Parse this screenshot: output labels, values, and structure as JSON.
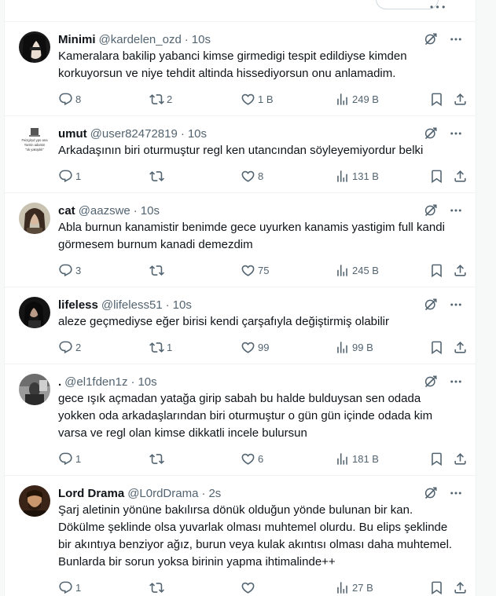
{
  "top": {
    "more_label": "• • •"
  },
  "tweets": [
    {
      "name": "Minimi",
      "handle": "@kardelen_ozd",
      "sep": "·",
      "time": "10s",
      "lines": [
        "Kameralara bakilip yabanci kimse girmedigi tespit edildiyse kimden",
        "korkuyorsun ve niye tehdit altinda hissediyorsun onu anlamadim."
      ],
      "replies": "8",
      "retweets": "2",
      "likes": "1 B",
      "views": "249 B",
      "avatar": "dark-hair"
    },
    {
      "name": "umut",
      "handle": "@user82472819",
      "sep": "·",
      "time": "10s",
      "lines": [
        "Arkadaşının biri oturmuştur regl ken utancından söyleyemiyordur belki"
      ],
      "replies": "1",
      "retweets": "",
      "likes": "8",
      "views": "131 B",
      "avatar": "text-meme",
      "avatar_text": [
        "Feizgiryd ypo ana",
        "Yarnin adamin",
        "\"ok yakışıklı\""
      ]
    },
    {
      "name": "cat",
      "handle": "@aazswe",
      "sep": "·",
      "time": "10s",
      "lines": [
        "Abla burnun kanamistir benimde gece uyurken kanamis yastigim full kandi",
        "görmesem burnum kanadi demezdim"
      ],
      "replies": "3",
      "retweets": "",
      "likes": "75",
      "views": "245 B",
      "avatar": "portrait-light"
    },
    {
      "name": "lifeless",
      "handle": "@lifeless51",
      "sep": "·",
      "time": "10s",
      "lines": [
        "aleze geçmediyse eğer birisi kendi çarşafıyla değiştirmiş olabilir"
      ],
      "replies": "2",
      "retweets": "1",
      "likes": "99",
      "views": "99 B",
      "avatar": "portrait-dark"
    },
    {
      "name": ".",
      "handle": "@el1fden1z",
      "sep": "·",
      "time": "10s",
      "lines": [
        "gece ışık açmadan yatağa girip sabah bu halde bulduysan sen odada",
        "yokken oda arkadaşlarından biri oturmuştur o gün gün içinde odada kim",
        "varsa ve regl olan kimse dikkatli incele bulursun"
      ],
      "replies": "1",
      "retweets": "",
      "likes": "6",
      "views": "181 B",
      "avatar": "photo-mono"
    },
    {
      "name": "Lord Drama",
      "handle": "@L0rdDrama",
      "sep": "·",
      "time": "2s",
      "lines": [
        "Şarj aletinin yönüne bakılırsa dönük olduğun yönde bulunan bir kan.",
        "Dökülme şeklinde olsa yuvarlak olması muhtemel olurdu. Bu elips şeklinde",
        "bir akıntıya benziyor ağız, burun veya kulak akıntısı olması daha muhtemel.",
        "Bunlarda bir sorun yoksa birinin yapma ihtimalinde++"
      ],
      "replies": "1",
      "retweets": "",
      "likes": "",
      "views": "27 B",
      "avatar": "portrait-warm"
    }
  ]
}
